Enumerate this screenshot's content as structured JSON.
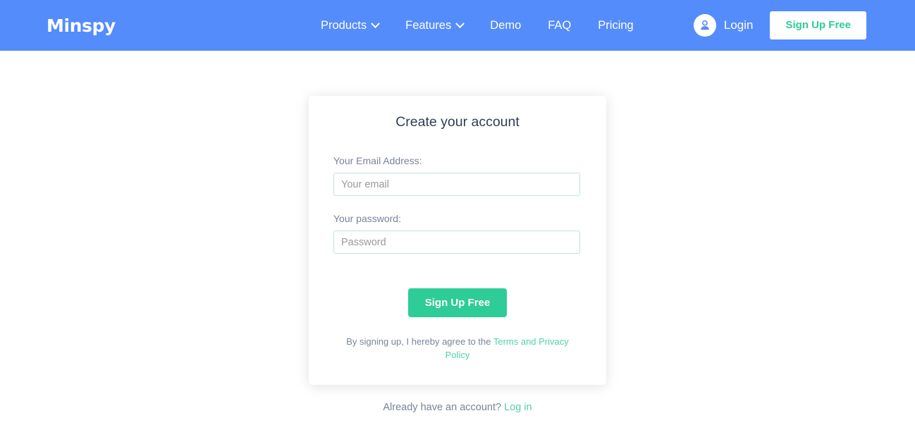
{
  "navbar": {
    "logo": "Minspy",
    "background_color": "#548cfc",
    "links": [
      {
        "label": "Products",
        "has_dropdown": true,
        "icon": "chevron-down-icon"
      },
      {
        "label": "Features",
        "has_dropdown": true,
        "icon": "chevron-down-icon"
      },
      {
        "label": "Demo",
        "has_dropdown": false,
        "icon": ""
      },
      {
        "label": "FAQ",
        "has_dropdown": false,
        "icon": ""
      },
      {
        "label": "Pricing",
        "has_dropdown": false,
        "icon": ""
      }
    ],
    "avatar_icon": "user-account-icon",
    "login_label": "Login",
    "signup_label": "Sign Up Free",
    "signup_text_color": "#2ecc96"
  },
  "card": {
    "title": "Create your account",
    "email": {
      "label": "Your Email Address:",
      "placeholder": "Your email",
      "value": ""
    },
    "password": {
      "label": "Your password:",
      "placeholder": "Password",
      "value": ""
    },
    "submit_label": "Sign Up Free",
    "submit_color": "#2ecc96",
    "terms_prefix": "By signing up, I hereby agree to the ",
    "terms_link": "Terms and Privacy Policy",
    "terms_link_color": "#4fd4a4"
  },
  "footer": {
    "prompt": "Already have an account?",
    "login_link": "Log in",
    "login_link_color": "#4fd4a4"
  }
}
